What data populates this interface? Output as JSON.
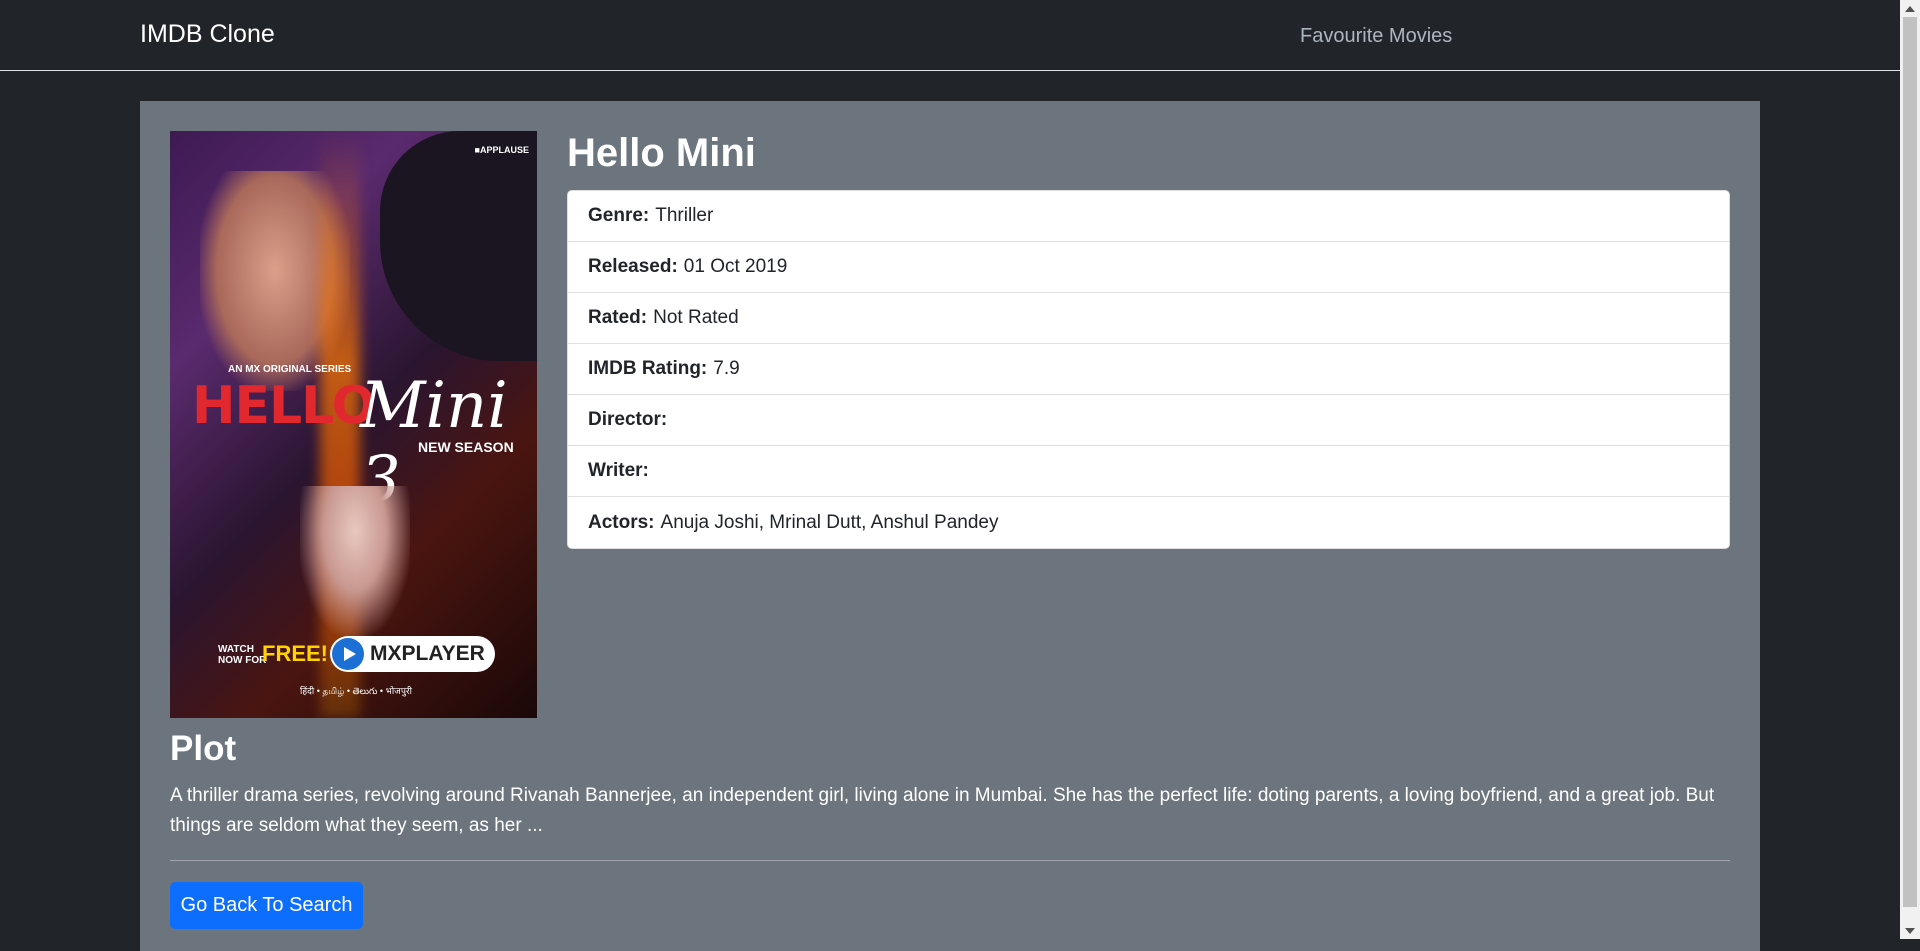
{
  "navbar": {
    "brand": "IMDB Clone",
    "favourites_link": "Favourite Movies"
  },
  "movie": {
    "title": "Hello Mini",
    "poster": {
      "publisher": "■APPLAUSE",
      "series_tag": "AN MX ORIGINAL SERIES",
      "title_part1": "HELLO",
      "title_part2": "Mini 3",
      "subtitle": "NEW SEASON",
      "watch_line1": "WATCH",
      "watch_line2": "NOW FOR",
      "free": "FREE!",
      "platform": "MXPLAYER",
      "languages": "हिंदी • தமிழ் • తెలుగు • भोजपुरी"
    },
    "details": [
      {
        "label": "Genre:",
        "value": "Thriller"
      },
      {
        "label": "Released:",
        "value": "01 Oct 2019"
      },
      {
        "label": "Rated:",
        "value": "Not Rated"
      },
      {
        "label": "IMDB Rating:",
        "value": "7.9"
      },
      {
        "label": "Director:",
        "value": ""
      },
      {
        "label": "Writer:",
        "value": ""
      },
      {
        "label": "Actors:",
        "value": "Anuja Joshi, Mrinal Dutt, Anshul Pandey"
      }
    ],
    "plot_heading": "Plot",
    "plot_text": "A thriller drama series, revolving around Rivanah Bannerjee, an independent girl, living alone in Mumbai. She has the perfect life: doting parents, a loving boyfriend, and a great job. But things are seldom what they seem, as her ..."
  },
  "actions": {
    "back_button": "Go Back To Search"
  },
  "icons": {
    "scroll_up": "scroll-up-arrow-icon",
    "scroll_down": "scroll-down-arrow-icon",
    "play": "play-icon"
  },
  "colors": {
    "background": "#212529",
    "card": "#6c757d",
    "primary_button": "#0d6efd",
    "nav_link": "#adb5bd"
  }
}
